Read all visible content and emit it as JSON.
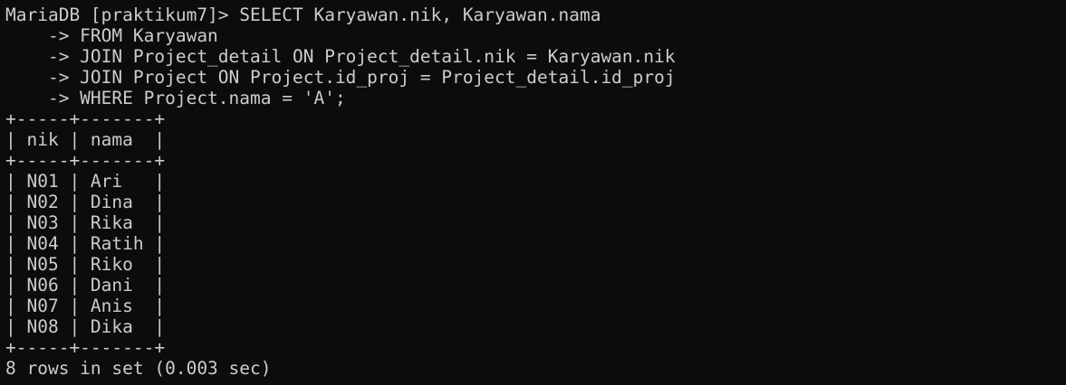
{
  "terminal": {
    "lines": [
      "MariaDB [praktikum7]> SELECT Karyawan.nik, Karyawan.nama",
      "    -> FROM Karyawan",
      "    -> JOIN Project_detail ON Project_detail.nik = Karyawan.nik",
      "    -> JOIN Project ON Project.id_proj = Project_detail.id_proj",
      "    -> WHERE Project.nama = 'A';",
      "+-----+-------+",
      "| nik | nama  |",
      "+-----+-------+",
      "| N01 | Ari   |",
      "| N02 | Dina  |",
      "| N03 | Rika  |",
      "| N04 | Ratih |",
      "| N05 | Riko  |",
      "| N06 | Dani  |",
      "| N07 | Anis  |",
      "| N08 | Dika  |",
      "+-----+-------+",
      "8 rows in set (0.003 sec)"
    ]
  }
}
